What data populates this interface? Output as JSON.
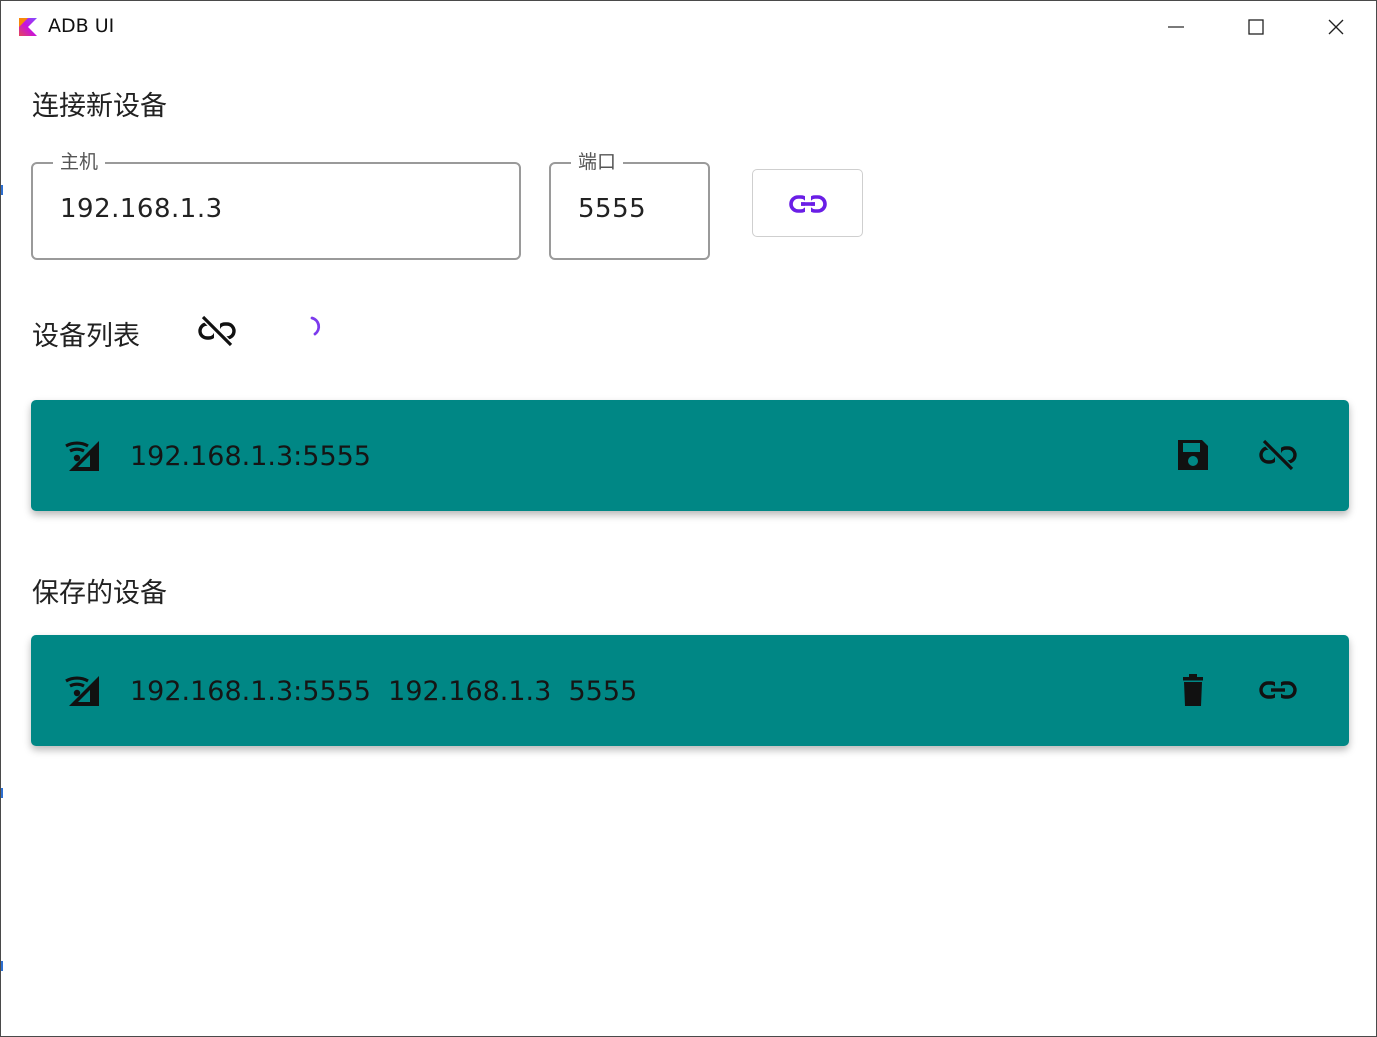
{
  "window": {
    "title": "ADB UI",
    "controls": [
      "minimize",
      "maximize",
      "close"
    ]
  },
  "connect_new": {
    "title": "连接新设备",
    "host_label": "主机",
    "host_value": "192.168.1.3",
    "port_label": "端口",
    "port_value": "5555",
    "connect_icon": "link-icon",
    "accent_color": "#6a1ee6"
  },
  "device_list": {
    "title": "设备列表",
    "disconnect_all_icon": "link-off-icon",
    "loading_icon": "progress-spinner-icon",
    "items": [
      {
        "text": "192.168.1.3:5555",
        "status_icon": "wifi-signal-icon",
        "actions": [
          "save-icon",
          "link-off-icon"
        ]
      }
    ]
  },
  "saved_devices": {
    "title": "保存的设备",
    "items": [
      {
        "text": "192.168.1.3:5555  192.168.1.3  5555",
        "status_icon": "wifi-signal-icon",
        "actions": [
          "delete-icon",
          "link-icon"
        ]
      }
    ]
  },
  "colors": {
    "card_background": "#008785",
    "spinner": "#7c3aed"
  }
}
